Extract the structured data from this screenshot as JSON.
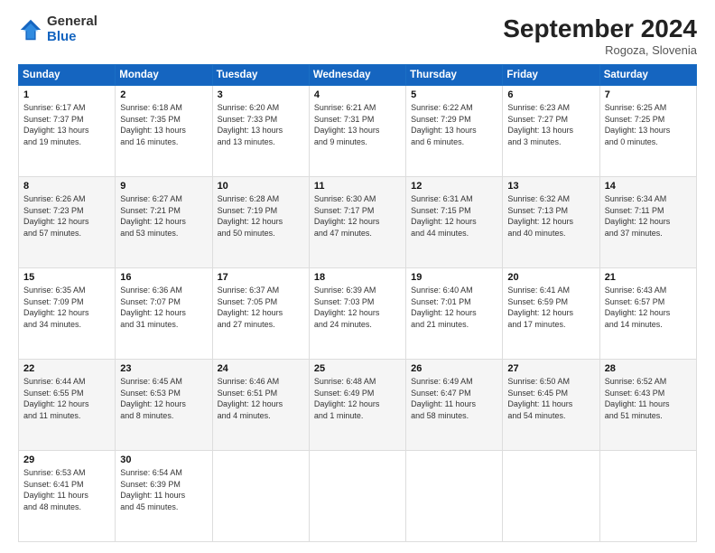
{
  "header": {
    "logo_general": "General",
    "logo_blue": "Blue",
    "month_title": "September 2024",
    "location": "Rogoza, Slovenia"
  },
  "days_of_week": [
    "Sunday",
    "Monday",
    "Tuesday",
    "Wednesday",
    "Thursday",
    "Friday",
    "Saturday"
  ],
  "weeks": [
    [
      {
        "day": 1,
        "lines": [
          "Sunrise: 6:17 AM",
          "Sunset: 7:37 PM",
          "Daylight: 13 hours",
          "and 19 minutes."
        ]
      },
      {
        "day": 2,
        "lines": [
          "Sunrise: 6:18 AM",
          "Sunset: 7:35 PM",
          "Daylight: 13 hours",
          "and 16 minutes."
        ]
      },
      {
        "day": 3,
        "lines": [
          "Sunrise: 6:20 AM",
          "Sunset: 7:33 PM",
          "Daylight: 13 hours",
          "and 13 minutes."
        ]
      },
      {
        "day": 4,
        "lines": [
          "Sunrise: 6:21 AM",
          "Sunset: 7:31 PM",
          "Daylight: 13 hours",
          "and 9 minutes."
        ]
      },
      {
        "day": 5,
        "lines": [
          "Sunrise: 6:22 AM",
          "Sunset: 7:29 PM",
          "Daylight: 13 hours",
          "and 6 minutes."
        ]
      },
      {
        "day": 6,
        "lines": [
          "Sunrise: 6:23 AM",
          "Sunset: 7:27 PM",
          "Daylight: 13 hours",
          "and 3 minutes."
        ]
      },
      {
        "day": 7,
        "lines": [
          "Sunrise: 6:25 AM",
          "Sunset: 7:25 PM",
          "Daylight: 13 hours",
          "and 0 minutes."
        ]
      }
    ],
    [
      {
        "day": 8,
        "lines": [
          "Sunrise: 6:26 AM",
          "Sunset: 7:23 PM",
          "Daylight: 12 hours",
          "and 57 minutes."
        ]
      },
      {
        "day": 9,
        "lines": [
          "Sunrise: 6:27 AM",
          "Sunset: 7:21 PM",
          "Daylight: 12 hours",
          "and 53 minutes."
        ]
      },
      {
        "day": 10,
        "lines": [
          "Sunrise: 6:28 AM",
          "Sunset: 7:19 PM",
          "Daylight: 12 hours",
          "and 50 minutes."
        ]
      },
      {
        "day": 11,
        "lines": [
          "Sunrise: 6:30 AM",
          "Sunset: 7:17 PM",
          "Daylight: 12 hours",
          "and 47 minutes."
        ]
      },
      {
        "day": 12,
        "lines": [
          "Sunrise: 6:31 AM",
          "Sunset: 7:15 PM",
          "Daylight: 12 hours",
          "and 44 minutes."
        ]
      },
      {
        "day": 13,
        "lines": [
          "Sunrise: 6:32 AM",
          "Sunset: 7:13 PM",
          "Daylight: 12 hours",
          "and 40 minutes."
        ]
      },
      {
        "day": 14,
        "lines": [
          "Sunrise: 6:34 AM",
          "Sunset: 7:11 PM",
          "Daylight: 12 hours",
          "and 37 minutes."
        ]
      }
    ],
    [
      {
        "day": 15,
        "lines": [
          "Sunrise: 6:35 AM",
          "Sunset: 7:09 PM",
          "Daylight: 12 hours",
          "and 34 minutes."
        ]
      },
      {
        "day": 16,
        "lines": [
          "Sunrise: 6:36 AM",
          "Sunset: 7:07 PM",
          "Daylight: 12 hours",
          "and 31 minutes."
        ]
      },
      {
        "day": 17,
        "lines": [
          "Sunrise: 6:37 AM",
          "Sunset: 7:05 PM",
          "Daylight: 12 hours",
          "and 27 minutes."
        ]
      },
      {
        "day": 18,
        "lines": [
          "Sunrise: 6:39 AM",
          "Sunset: 7:03 PM",
          "Daylight: 12 hours",
          "and 24 minutes."
        ]
      },
      {
        "day": 19,
        "lines": [
          "Sunrise: 6:40 AM",
          "Sunset: 7:01 PM",
          "Daylight: 12 hours",
          "and 21 minutes."
        ]
      },
      {
        "day": 20,
        "lines": [
          "Sunrise: 6:41 AM",
          "Sunset: 6:59 PM",
          "Daylight: 12 hours",
          "and 17 minutes."
        ]
      },
      {
        "day": 21,
        "lines": [
          "Sunrise: 6:43 AM",
          "Sunset: 6:57 PM",
          "Daylight: 12 hours",
          "and 14 minutes."
        ]
      }
    ],
    [
      {
        "day": 22,
        "lines": [
          "Sunrise: 6:44 AM",
          "Sunset: 6:55 PM",
          "Daylight: 12 hours",
          "and 11 minutes."
        ]
      },
      {
        "day": 23,
        "lines": [
          "Sunrise: 6:45 AM",
          "Sunset: 6:53 PM",
          "Daylight: 12 hours",
          "and 8 minutes."
        ]
      },
      {
        "day": 24,
        "lines": [
          "Sunrise: 6:46 AM",
          "Sunset: 6:51 PM",
          "Daylight: 12 hours",
          "and 4 minutes."
        ]
      },
      {
        "day": 25,
        "lines": [
          "Sunrise: 6:48 AM",
          "Sunset: 6:49 PM",
          "Daylight: 12 hours",
          "and 1 minute."
        ]
      },
      {
        "day": 26,
        "lines": [
          "Sunrise: 6:49 AM",
          "Sunset: 6:47 PM",
          "Daylight: 11 hours",
          "and 58 minutes."
        ]
      },
      {
        "day": 27,
        "lines": [
          "Sunrise: 6:50 AM",
          "Sunset: 6:45 PM",
          "Daylight: 11 hours",
          "and 54 minutes."
        ]
      },
      {
        "day": 28,
        "lines": [
          "Sunrise: 6:52 AM",
          "Sunset: 6:43 PM",
          "Daylight: 11 hours",
          "and 51 minutes."
        ]
      }
    ],
    [
      {
        "day": 29,
        "lines": [
          "Sunrise: 6:53 AM",
          "Sunset: 6:41 PM",
          "Daylight: 11 hours",
          "and 48 minutes."
        ]
      },
      {
        "day": 30,
        "lines": [
          "Sunrise: 6:54 AM",
          "Sunset: 6:39 PM",
          "Daylight: 11 hours",
          "and 45 minutes."
        ]
      },
      null,
      null,
      null,
      null,
      null
    ]
  ]
}
